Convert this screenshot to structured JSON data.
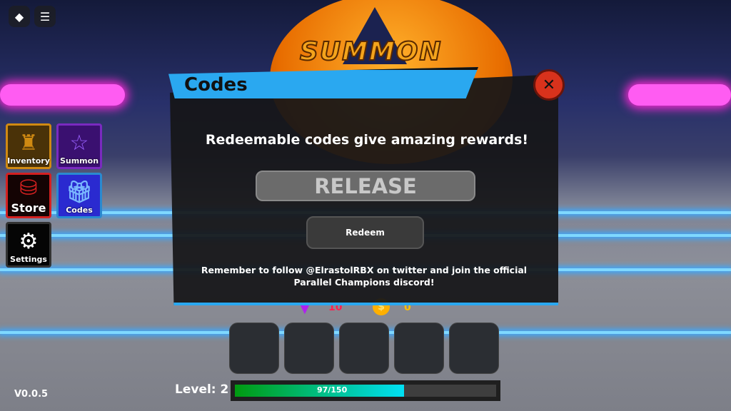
{
  "hud": {
    "roblox_icon": "roblox-logo-icon",
    "menu_icon": "hamburger-menu-icon",
    "version": "V0.0.5"
  },
  "scene": {
    "sign_text": "SUMMON"
  },
  "side_menu": [
    {
      "label": "Inventory",
      "icon": "castle-tower-icon",
      "color": "#d08a12"
    },
    {
      "label": "Summon",
      "icon": "pentagram-star-icon",
      "color": "#7a2ac0"
    },
    {
      "label": "Store",
      "icon": "treasure-chest-icon",
      "color": "#d42020"
    },
    {
      "label": "Codes",
      "icon": "gift-box-icon",
      "color": "#2a8ad0"
    },
    {
      "label": "Settings",
      "icon": "gear-icon",
      "color": "#222222"
    }
  ],
  "codes_dialog": {
    "title": "Codes",
    "close_icon": "close-x-icon",
    "description": "Redeemable codes give amazing rewards!",
    "code_input_value": "RELEASE",
    "redeem_label": "Redeem",
    "note": "Remember to follow @ElrastolRBX on twitter and join the official Parallel Champions discord!",
    "accent": "#2aa8f0"
  },
  "currency": {
    "gems": "10",
    "coins": "0"
  },
  "hotbar_slots": 5,
  "level": {
    "label": "Level: 2",
    "xp_text": "97/150",
    "xp_current": 97,
    "xp_max": 150
  }
}
